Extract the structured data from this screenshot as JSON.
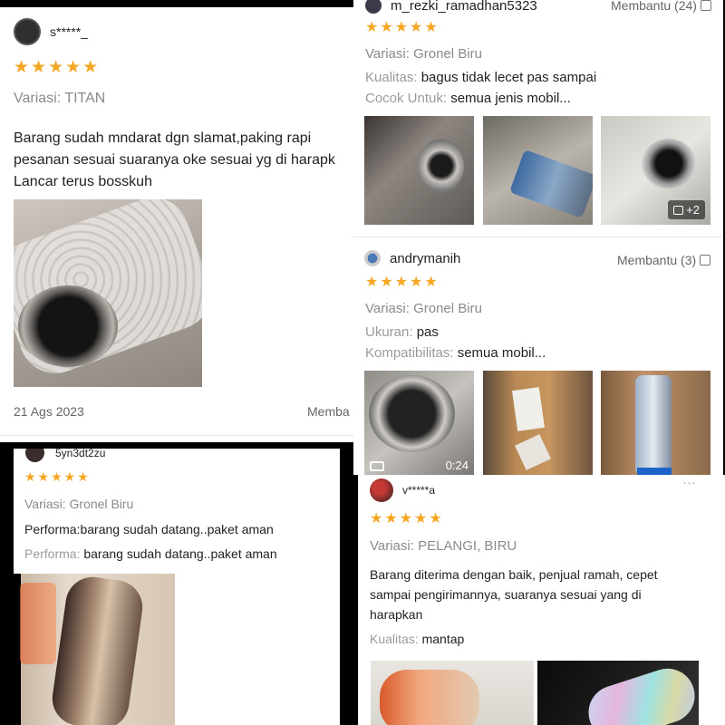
{
  "review1": {
    "username": "s*****_",
    "stars": "★★★★★",
    "variant": "Variasi: TITAN",
    "text_lines": [
      "Barang sudah mndarat dgn slamat,paking rapi",
      "pesanan sesuai suaranya oke sesuai yg di harapk",
      "Lancar terus bosskuh"
    ],
    "date": "21 Ags 2023",
    "helpful": "Memba"
  },
  "review2": {
    "username": "m_rezki_ramadhan5323",
    "helpful": "Membantu (24)",
    "stars": "★★★★★",
    "variant": "Variasi: Gronel Biru",
    "attr1_label": "Kualitas:",
    "attr1_value": "bagus tidak lecet pas sampai",
    "attr2_label": "Cocok Untuk:",
    "attr2_value": "semua jenis mobil...",
    "more_photos": "+2"
  },
  "review3": {
    "username": "andrymanih",
    "helpful": "Membantu (3)",
    "stars": "★★★★★",
    "variant": "Variasi: Gronel Biru",
    "attr1_label": "Ukuran:",
    "attr1_value": "pas",
    "attr2_label": "Kompatibilitas:",
    "attr2_value": "semua mobil...",
    "video_duration": "0:24"
  },
  "review4": {
    "username": "5yn3dt2zu",
    "stars": "★★★★★",
    "variant": "Variasi: Gronel Biru",
    "text": "Performa:barang sudah datang..paket aman",
    "attr_label": "Performa:",
    "attr_value": "barang sudah datang..paket aman"
  },
  "review5": {
    "username": "v*****a",
    "stars": "★★★★★",
    "variant": "Variasi: PELANGI, BIRU",
    "text_lines": [
      "Barang diterima dengan baik, penjual ramah, cepet",
      "sampai pengirimannya, suaranya sesuai yang di",
      "harapkan"
    ],
    "attr_label": "Kualitas:",
    "attr_value": "mantap",
    "more": "···"
  }
}
